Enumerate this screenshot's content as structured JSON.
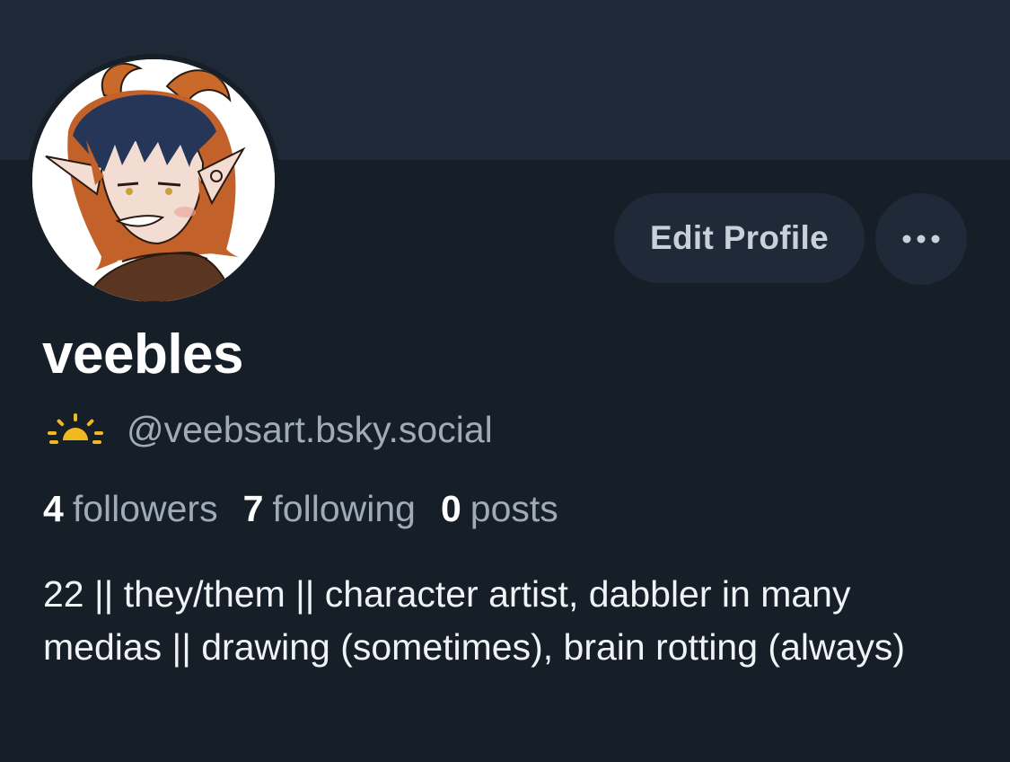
{
  "profile": {
    "display_name": "veebles",
    "handle": "@veebsart.bsky.social",
    "handle_emoji": "sunrise-icon",
    "bio": "22 || they/them || character artist, dabbler in many medias || drawing (sometimes), brain rotting (always)"
  },
  "actions": {
    "edit_label": "Edit Profile",
    "more_icon": "more-horizontal-icon"
  },
  "stats": {
    "followers": {
      "count": "4",
      "label": "followers"
    },
    "following": {
      "count": "7",
      "label": "following"
    },
    "posts": {
      "count": "0",
      "label": "posts"
    }
  },
  "colors": {
    "background": "#161e27",
    "banner": "#1f2836",
    "button_bg": "#1f2937",
    "muted_text": "#a0abba",
    "primary_text": "#ffffff"
  }
}
